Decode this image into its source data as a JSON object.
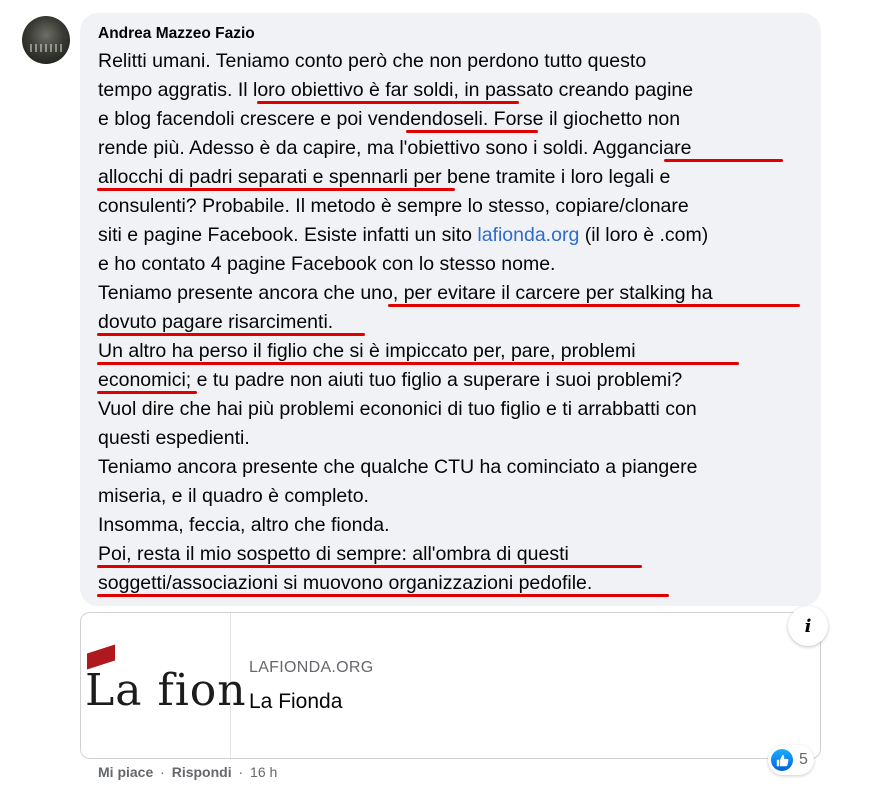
{
  "comment": {
    "author": "Andrea Mazzeo Fazio",
    "lines": [
      "Relitti umani. Teniamo conto però che non perdono tutto questo",
      "tempo aggratis. Il loro obiettivo è far soldi, in passato creando pagine",
      "e blog facendoli crescere e poi vendendoseli. Forse il giochetto non",
      "rende più. Adesso è da capire, ma l'obiettivo sono i soldi. Agganciare",
      "allocchi di padri separati e spennarli per bene tramite i loro legali e",
      "consulenti? Probabile. Il metodo è sempre lo stesso, copiare/clonare",
      "siti e pagine Facebook. Esiste infatti un sito ",
      "e ho contato 4 pagine Facebook con lo stesso nome.",
      "Teniamo presente ancora che uno, per evitare il carcere per stalking ha",
      "dovuto pagare risarcimenti.",
      "Un altro ha perso il figlio che si è impiccato per, pare, problemi",
      "economici; e tu padre non aiuti tuo figlio a superare i suoi problemi?",
      "Vuol dire che hai più problemi econonici di tuo figlio e ti arrabbatti con",
      "questi espedienti.",
      "Teniamo ancora presente che qualche CTU ha cominciato a piangere",
      "miseria, e il quadro è completo.",
      "Insomma, feccia, altro che fionda.",
      "Poi, resta il mio sospetto di sempre: all'ombra di questi",
      "soggetti/associazioni si muovono organizzazioni pedofile."
    ],
    "link_text": "lafionda.org",
    "after_link": " (il loro è .com)"
  },
  "link_card": {
    "logo_text": "La fion",
    "domain": "LAFIONDA.ORG",
    "title": "La Fionda"
  },
  "actions": {
    "like": "Mi piace",
    "reply": "Rispondi",
    "separator": "·",
    "time": "16 h"
  },
  "reactions": {
    "count": "5",
    "icon": "like-icon"
  },
  "colors": {
    "underline": "#e00000",
    "link": "#2d6bcf",
    "bubble": "#f0f2f5"
  }
}
